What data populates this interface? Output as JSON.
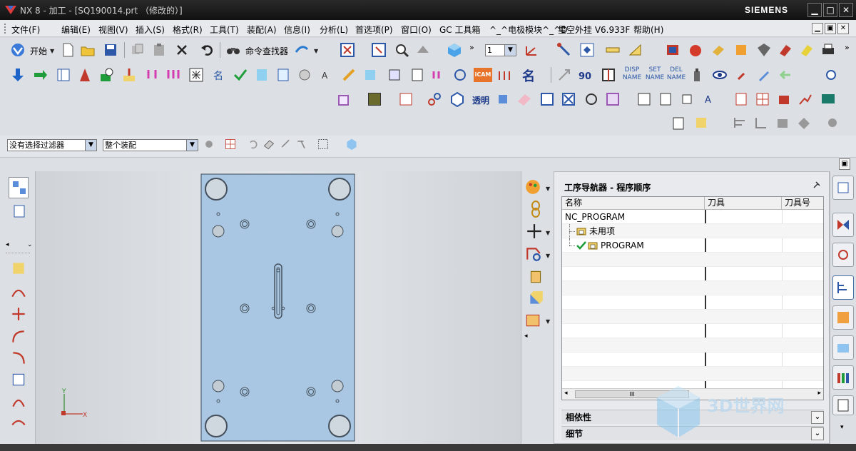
{
  "window": {
    "title": "NX 8 - 加工 - [SQ190014.prt （修改的）]",
    "brand": "SIEMENS",
    "controls": {
      "minimize": "▁",
      "maximize": "□",
      "close": "✕"
    }
  },
  "menu": {
    "items": [
      "文件(F)",
      "编辑(E)",
      "视图(V)",
      "插入(S)",
      "格式(R)",
      "工具(T)",
      "装配(A)",
      "信息(I)",
      "分析(L)",
      "首选项(P)",
      "窗口(O)",
      "GC 工具箱",
      "^_^电极模块^_^D",
      "星空外挂 V6.933F",
      "帮助(H)"
    ],
    "mdi_controls": [
      "▁",
      "▣",
      "✕"
    ]
  },
  "toolbar": {
    "start_label": "开始",
    "command_finder_label": "命令查找器",
    "layer_value": "1",
    "transparency_label": "透明",
    "icam_label": "iCAM",
    "name_label": "名",
    "disp_name": [
      "DISP",
      "NAME"
    ],
    "set_name": [
      "SET",
      "NAME"
    ],
    "del_name": [
      "DEL",
      "NAME"
    ]
  },
  "filters": {
    "selection_filter": "没有选择过滤器",
    "assembly_scope": "整个装配"
  },
  "navigator": {
    "title": "工序导航器 - 程序顺序",
    "columns": [
      "名称",
      "刀具",
      "刀具号"
    ],
    "rows": [
      {
        "name": "NC_PROGRAM",
        "level": 0,
        "icon": ""
      },
      {
        "name": "未用项",
        "level": 1,
        "icon": "folder-icon"
      },
      {
        "name": "PROGRAM",
        "level": 1,
        "icon": "folder-check-icon"
      }
    ],
    "scroll_thumb": "III",
    "sections": [
      "相依性",
      "细节"
    ]
  },
  "viewport": {
    "axis_labels": {
      "x": "X",
      "y": "Y"
    }
  },
  "colors": {
    "plate_fill": "#a9c7e2",
    "accent": "#1a5fb4",
    "titlebar": "#1b1b1b"
  },
  "watermark": "3D世界网"
}
